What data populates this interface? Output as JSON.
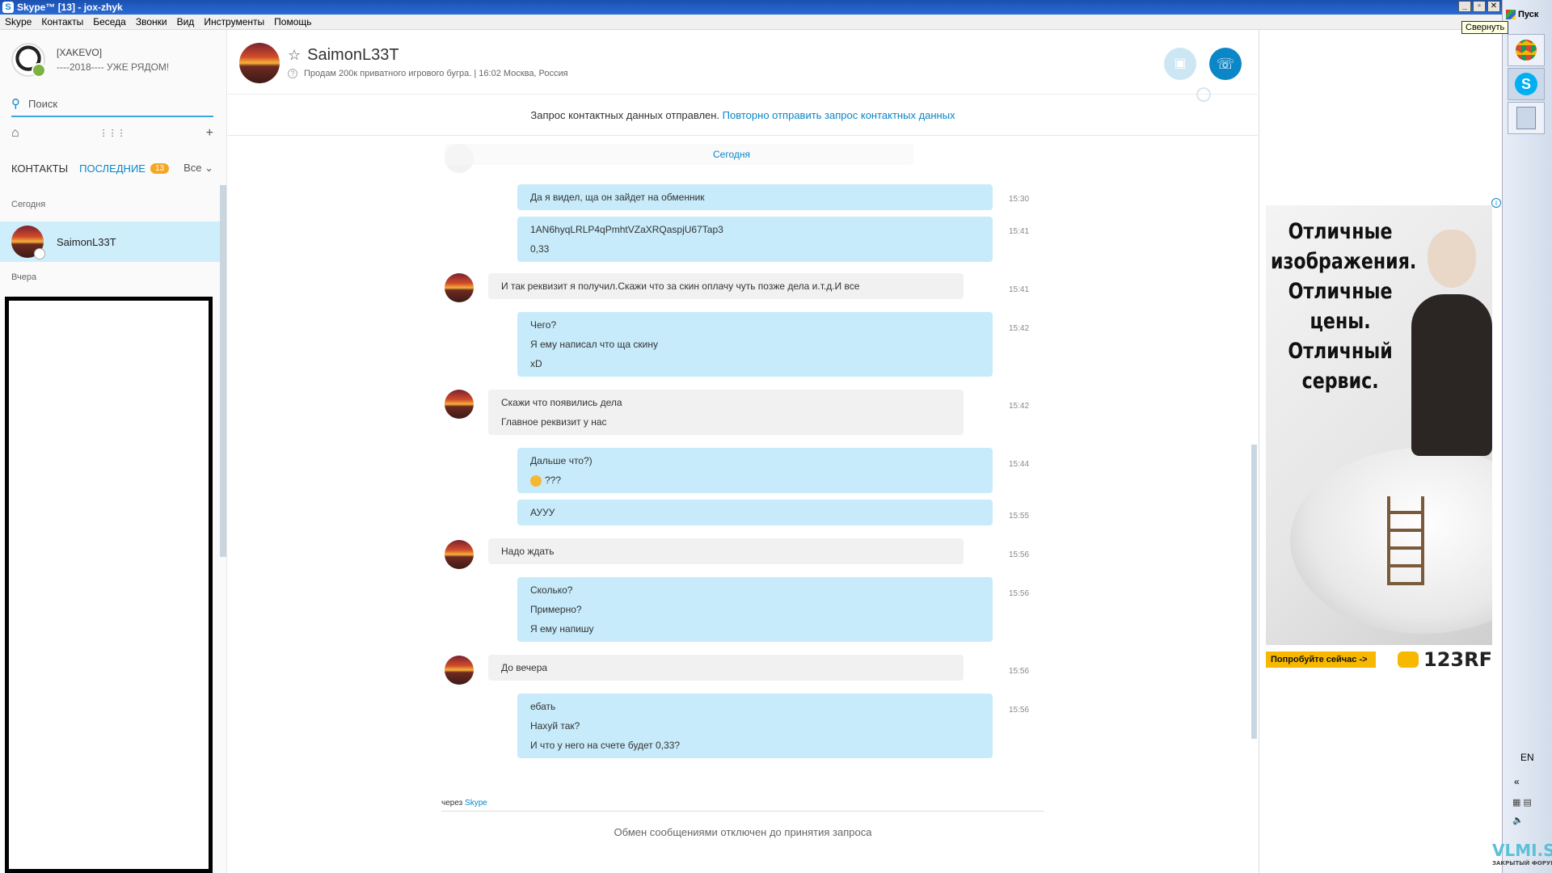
{
  "window": {
    "title": "Skype™ [13] - jox-zhyk",
    "logo_letter": "S",
    "btn_min": "_",
    "btn_max": "▫",
    "btn_close": "✕"
  },
  "menu": [
    "Skype",
    "Контакты",
    "Беседа",
    "Звонки",
    "Вид",
    "Инструменты",
    "Помощь"
  ],
  "profile": {
    "name": "[XAKEVO]",
    "mood": "----2018---- УЖЕ РЯДОМ!"
  },
  "search": {
    "placeholder": "Поиск",
    "icon": "search-icon"
  },
  "tabs": {
    "contacts": "КОНТАКТЫ",
    "recent": "ПОСЛЕДНИЕ",
    "recent_badge": "13",
    "filter": "Все"
  },
  "sidebar": {
    "today": "Сегодня",
    "yesterday": "Вчера",
    "contact_name": "SaimonL33T"
  },
  "header": {
    "name": "SaimonL33T",
    "mood": "Продам 200к приватного игрового бугра.",
    "local_time": "16:02 Москва, Россия"
  },
  "notice": {
    "text": "Запрос контактных данных отправлен.",
    "link": "Повторно отправить запрос контактных данных"
  },
  "chat": {
    "day_separator": "Сегодня",
    "messages": [
      {
        "dir": "out",
        "time": "15:30",
        "lines": [
          "Да я видел, ща он зайдет на обменник"
        ]
      },
      {
        "dir": "out",
        "time": "15:41",
        "lines": [
          "1AN6hyqLRLP4qPmhtVZaXRQaspjU67Tap3",
          "0,33"
        ]
      },
      {
        "dir": "in",
        "time": "15:41",
        "lines": [
          "И так реквизит я получил.Скажи что за скин оплачу чуть позже дела и.т.д.И все"
        ]
      },
      {
        "dir": "out",
        "time": "15:42",
        "lines": [
          "Чего?",
          "Я ему написал что ща скину",
          "xD"
        ]
      },
      {
        "dir": "in",
        "time": "15:42",
        "lines": [
          "Скажи что появились дела",
          "Главное реквизит у нас"
        ]
      },
      {
        "dir": "out",
        "time": "15:44",
        "lines": [
          "Дальше что?)",
          "???"
        ]
      },
      {
        "dir": "out",
        "time": "15:55",
        "lines": [
          "АУУУ"
        ]
      },
      {
        "dir": "in",
        "time": "15:56",
        "lines": [
          "Надо ждать"
        ]
      },
      {
        "dir": "out",
        "time": "15:56",
        "lines": [
          "Сколько?",
          "Примерно?",
          "Я ему напишу"
        ]
      },
      {
        "dir": "in",
        "time": "15:56",
        "lines": [
          "До вечера"
        ]
      },
      {
        "dir": "out",
        "time": "15:56",
        "lines": [
          "ебать",
          "Нахуй так?",
          "И что у него на счете будет 0,33?"
        ]
      }
    ],
    "via_prefix": "через",
    "via_link": "Skype",
    "disabled_note": "Обмен сообщениями отключен до принятия запроса"
  },
  "ad": {
    "lines": [
      "Отличные",
      "изображения.",
      "Отличные",
      "цены.",
      "Отличный",
      "сервис."
    ],
    "cta": "Попробуйте сейчас ->",
    "brand": "123RF"
  },
  "taskbar": {
    "start": "Пуск",
    "tooltip": "Свернуть",
    "lang": "EN",
    "arrows": "«"
  },
  "watermark": {
    "main": "VLMI.SU",
    "sub": "ЗАКРЫТЫЙ ФОРУМ"
  }
}
